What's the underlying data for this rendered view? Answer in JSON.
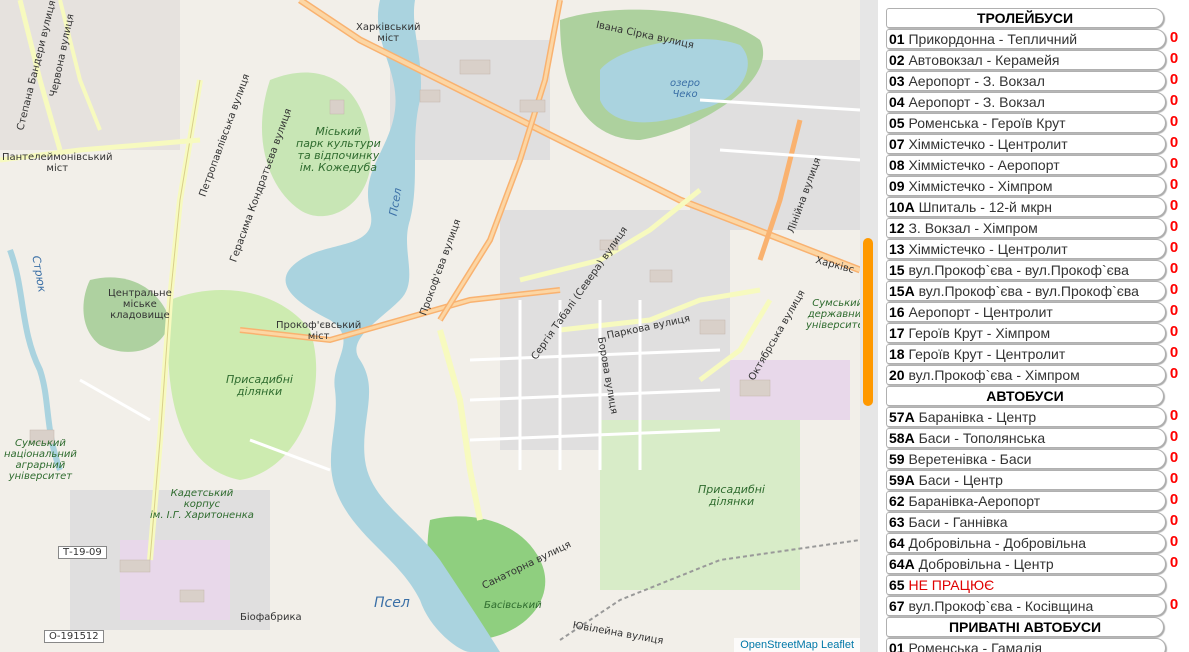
{
  "map": {
    "attribution_osm": "OpenStreetMap",
    "attribution_leaflet": "Leaflet",
    "labels": {
      "kharkivskyi_mist": "Харківський\nміст",
      "ivana_sirka": "Івана Сірка вулиця",
      "ozero_cheko": "озеро\nЧеко",
      "stepana_bandery": "Степана Бандери вулиця",
      "chervonoi": "Червона вулиця",
      "petropavlivska": "Петропавлівська вулиця",
      "gerasyma_kondratieva": "Герасима Кондратьєва вулиця",
      "park": "Міський\nпарк культури\nта відпочинку\nім. Кожедуба",
      "panteleimonivskyi": "Пантелеймонівський\nміст",
      "psel1": "Псел",
      "prokofieva_vul": "Прокоф'єва вулиця",
      "striuk": "Стрюк",
      "kladovyshche": "Центральне\nміське\nкладовище",
      "prokofievskyi_mist": "Прокоф'євський\nміст",
      "prysadybni1": "Присадибні\nділянки",
      "serhiia_tabali": "Сергія Табалі (Севера) вулиця",
      "parkova": "Паркова вулиця",
      "borova": "Борова вулиця",
      "oktiabrska": "Октябрська вулиця",
      "liniina": "Лінійна вулиця",
      "sumskyi_univ": "Сумський\nдержавний\nуніверситет",
      "kharkiv_road": "Харківс",
      "sumskyi_agrar": "Сумський\nнаціональний\nаграрний\nуніверситет",
      "kadetskyi": "Кадетський\nкорпус\nім. І.Г. Харитоненка",
      "t1909": "Т-19-09",
      "prysadybni2": "Присадибні\nділянки",
      "sanatorna": "Санаторна вулиця",
      "psel2": "Псел",
      "basivskyi": "Басівський",
      "biofabryka": "Біофабрика",
      "o191512": "О-191512",
      "yuvileina": "Ювілейна вулиця"
    }
  },
  "panel": {
    "sections": [
      {
        "title": "ТРОЛЕЙБУСИ",
        "routes": [
          {
            "num": "01",
            "desc": "Прикордонна - Тепличний",
            "count": "0"
          },
          {
            "num": "02",
            "desc": "Автовокзал - Керамейя",
            "count": "0"
          },
          {
            "num": "03",
            "desc": "Аеропорт - З. Вокзал",
            "count": "0"
          },
          {
            "num": "04",
            "desc": "Аеропорт - З. Вокзал",
            "count": "0"
          },
          {
            "num": "05",
            "desc": "Роменська - Героїв Крут",
            "count": "0"
          },
          {
            "num": "07",
            "desc": "Хіммістечко - Центролит",
            "count": "0"
          },
          {
            "num": "08",
            "desc": "Хіммістечко - Аеропорт",
            "count": "0"
          },
          {
            "num": "09",
            "desc": "Хіммістечко - Хімпром",
            "count": "0"
          },
          {
            "num": "10А",
            "desc": "Шпиталь - 12-й мкрн",
            "count": "0"
          },
          {
            "num": "12",
            "desc": "З. Вокзал - Хімпром",
            "count": "0"
          },
          {
            "num": "13",
            "desc": "Хіммістечко - Центролит",
            "count": "0"
          },
          {
            "num": "15",
            "desc": "вул.Прокоф`єва - вул.Прокоф`єва",
            "count": "0"
          },
          {
            "num": "15А",
            "desc": "вул.Прокоф`єва - вул.Прокоф`єва",
            "count": "0"
          },
          {
            "num": "16",
            "desc": "Аеропорт - Центролит",
            "count": "0"
          },
          {
            "num": "17",
            "desc": "Героїв Крут - Хімпром",
            "count": "0"
          },
          {
            "num": "18",
            "desc": "Героїв Крут - Центролит",
            "count": "0"
          },
          {
            "num": "20",
            "desc": "вул.Прокоф`єва - Хімпром",
            "count": "0"
          }
        ]
      },
      {
        "title": "АВТОБУСИ",
        "routes": [
          {
            "num": "57А",
            "desc": "Баранівка - Центр",
            "count": "0"
          },
          {
            "num": "58А",
            "desc": "Баси - Тополянська",
            "count": "0"
          },
          {
            "num": "59",
            "desc": "Веретенівка - Баси",
            "count": "0"
          },
          {
            "num": "59А",
            "desc": "Баси - Центр",
            "count": "0"
          },
          {
            "num": "62",
            "desc": "Баранівка-Аеропорт",
            "count": "0"
          },
          {
            "num": "63",
            "desc": "Баси - Ганнівка",
            "count": "0"
          },
          {
            "num": "64",
            "desc": "Добровільна - Добровільна",
            "count": "0"
          },
          {
            "num": "64А",
            "desc": "Добровільна - Центр",
            "count": "0"
          },
          {
            "num": "65",
            "desc": "НЕ ПРАЦЮЄ",
            "count": "",
            "warn": true
          },
          {
            "num": "67",
            "desc": "вул.Прокоф`єва - Косівщина",
            "count": "0"
          }
        ]
      },
      {
        "title": "ПРИВАТНІ АВТОБУСИ",
        "routes": [
          {
            "num": "01",
            "desc": "Роменська - Гамалія",
            "count": ""
          }
        ]
      }
    ],
    "colors": {
      "count": "#ff0000",
      "warn": "#e00000",
      "scroll_thumb": "#ff9900"
    }
  }
}
